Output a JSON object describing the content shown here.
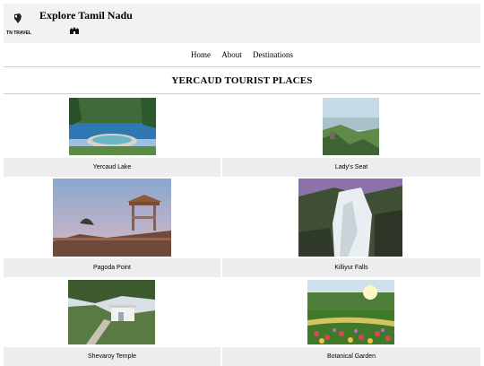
{
  "header": {
    "site_title": "Explore Tamil Nadu",
    "logo_text": "TN TRAVEL"
  },
  "nav": {
    "items": [
      "Home",
      "About",
      "Destinations"
    ]
  },
  "page": {
    "title": "YERCAUD TOURIST PLACES"
  },
  "places": [
    {
      "name": "Yercaud Lake"
    },
    {
      "name": "Lady's Seat"
    },
    {
      "name": "Pagoda Point"
    },
    {
      "name": "Killiyur Falls"
    },
    {
      "name": "Shevaroy Temple"
    },
    {
      "name": "Botanical Garden"
    }
  ]
}
